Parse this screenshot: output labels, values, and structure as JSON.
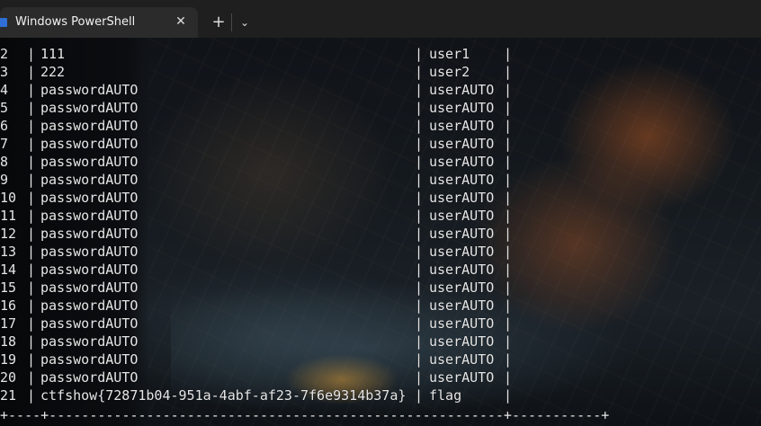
{
  "window": {
    "tab_title": "Windows PowerShell",
    "close_glyph": "✕",
    "new_tab_glyph": "+",
    "dropdown_glyph": "⌄",
    "accent": "#2f6fd6"
  },
  "table": {
    "separator": "|",
    "rows": [
      {
        "id": "2",
        "password": "111",
        "username": "user1"
      },
      {
        "id": "3",
        "password": "222",
        "username": "user2"
      },
      {
        "id": "4",
        "password": "passwordAUTO",
        "username": "userAUTO"
      },
      {
        "id": "5",
        "password": "passwordAUTO",
        "username": "userAUTO"
      },
      {
        "id": "6",
        "password": "passwordAUTO",
        "username": "userAUTO"
      },
      {
        "id": "7",
        "password": "passwordAUTO",
        "username": "userAUTO"
      },
      {
        "id": "8",
        "password": "passwordAUTO",
        "username": "userAUTO"
      },
      {
        "id": "9",
        "password": "passwordAUTO",
        "username": "userAUTO"
      },
      {
        "id": "10",
        "password": "passwordAUTO",
        "username": "userAUTO"
      },
      {
        "id": "11",
        "password": "passwordAUTO",
        "username": "userAUTO"
      },
      {
        "id": "12",
        "password": "passwordAUTO",
        "username": "userAUTO"
      },
      {
        "id": "13",
        "password": "passwordAUTO",
        "username": "userAUTO"
      },
      {
        "id": "14",
        "password": "passwordAUTO",
        "username": "userAUTO"
      },
      {
        "id": "15",
        "password": "passwordAUTO",
        "username": "userAUTO"
      },
      {
        "id": "16",
        "password": "passwordAUTO",
        "username": "userAUTO"
      },
      {
        "id": "17",
        "password": "passwordAUTO",
        "username": "userAUTO"
      },
      {
        "id": "18",
        "password": "passwordAUTO",
        "username": "userAUTO"
      },
      {
        "id": "19",
        "password": "passwordAUTO",
        "username": "userAUTO"
      },
      {
        "id": "20",
        "password": "passwordAUTO",
        "username": "userAUTO"
      },
      {
        "id": "21",
        "password": "ctfshow{72871b04-951a-4abf-af23-7f6e9314b37a}",
        "username": "flag"
      }
    ],
    "bottom_border": "+----+--------------------------------------------------------+-----------+"
  }
}
